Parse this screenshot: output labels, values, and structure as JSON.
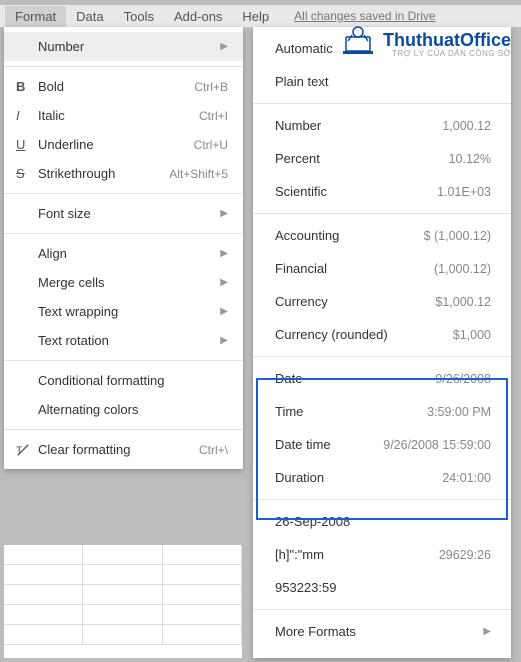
{
  "menubar": {
    "items": [
      "Format",
      "Data",
      "Tools",
      "Add-ons",
      "Help"
    ],
    "drive_status": "All changes saved in Drive"
  },
  "logo": {
    "title": "ThuthuatOffice",
    "subtitle": "TRỢ LÝ CỦA DÂN CÔNG SỞ"
  },
  "format_menu": {
    "number": "Number",
    "bold": {
      "label": "Bold",
      "shortcut": "Ctrl+B"
    },
    "italic": {
      "label": "Italic",
      "shortcut": "Ctrl+I"
    },
    "underline": {
      "label": "Underline",
      "shortcut": "Ctrl+U"
    },
    "strike": {
      "label": "Strikethrough",
      "shortcut": "Alt+Shift+5"
    },
    "font_size": "Font size",
    "align": "Align",
    "merge": "Merge cells",
    "wrap": "Text wrapping",
    "rotation": "Text rotation",
    "conditional": "Conditional formatting",
    "altcolors": "Alternating colors",
    "clear": {
      "label": "Clear formatting",
      "shortcut": "Ctrl+\\"
    }
  },
  "number_menu": {
    "automatic": "Automatic",
    "plain": "Plain text",
    "items": [
      {
        "label": "Number",
        "example": "1,000.12"
      },
      {
        "label": "Percent",
        "example": "10.12%"
      },
      {
        "label": "Scientific",
        "example": "1.01E+03"
      }
    ],
    "items2": [
      {
        "label": "Accounting",
        "example": "$ (1,000.12)"
      },
      {
        "label": "Financial",
        "example": "(1,000.12)"
      },
      {
        "label": "Currency",
        "example": "$1,000.12"
      },
      {
        "label": "Currency (rounded)",
        "example": "$1,000"
      }
    ],
    "items3": [
      {
        "label": "Date",
        "example": "9/26/2008"
      },
      {
        "label": "Time",
        "example": "3:59:00 PM"
      },
      {
        "label": "Date time",
        "example": "9/26/2008 15:59:00"
      },
      {
        "label": "Duration",
        "example": "24:01:00"
      }
    ],
    "items4": [
      {
        "label": "26-Sep-2008",
        "example": ""
      },
      {
        "label": "[h]\":\"mm",
        "example": "29629:26"
      },
      {
        "label": "953223:59",
        "example": ""
      }
    ],
    "more": "More Formats"
  }
}
